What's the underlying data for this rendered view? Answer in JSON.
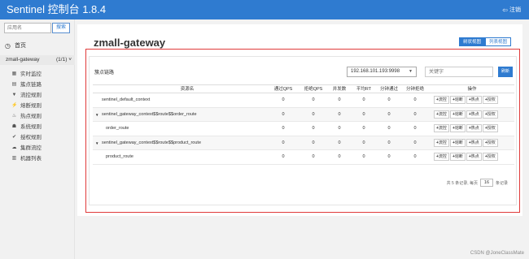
{
  "header": {
    "title": "Sentinel 控制台 1.8.4",
    "logout_label": "注销",
    "logout_icon": "logout-icon",
    "bg_color": "#2f7bd0"
  },
  "sidebar": {
    "search_placeholder": "应用名",
    "search_button": "搜索",
    "home_label": "首页",
    "app": {
      "name": "zmall-gateway",
      "count": "(1/1)"
    },
    "items": [
      {
        "icon": "chart-icon",
        "glyph": "▦",
        "label": "实时监控"
      },
      {
        "icon": "list-icon",
        "glyph": "▤",
        "label": "簇点链路"
      },
      {
        "icon": "filter-icon",
        "glyph": "▼",
        "label": "流控规则"
      },
      {
        "icon": "flash-icon",
        "glyph": "⚡",
        "label": "熔断规则"
      },
      {
        "icon": "fire-icon",
        "glyph": "♨",
        "label": "热点规则"
      },
      {
        "icon": "system-icon",
        "glyph": "☗",
        "label": "系统规则"
      },
      {
        "icon": "check-icon",
        "glyph": "✔",
        "label": "授权规则"
      },
      {
        "icon": "cloud-icon",
        "glyph": "☁",
        "label": "集群流控"
      },
      {
        "icon": "machine-icon",
        "glyph": "▥",
        "label": "机器列表"
      }
    ]
  },
  "main": {
    "page_title": "zmall-gateway",
    "view_buttons": [
      "树状视图",
      "列表视图"
    ],
    "card_title": "簇点链路",
    "machine_select": "192.168.101.193:9998",
    "keyword_placeholder": "关键字",
    "refresh_label": "刷新",
    "columns": [
      "资源名",
      "通过QPS",
      "拒绝QPS",
      "并发数",
      "平均RT",
      "分钟通过",
      "分钟拒绝",
      "操作"
    ],
    "rows": [
      {
        "name": "sentinel_default_context",
        "expand": "",
        "indent": 0,
        "values": [
          "0",
          "0",
          "0",
          "0",
          "0",
          "0"
        ]
      },
      {
        "name": "sentinel_gateway_context$$route$$order_route",
        "expand": "▼",
        "indent": 0,
        "values": [
          "0",
          "0",
          "0",
          "0",
          "0",
          "0"
        ]
      },
      {
        "name": "order_route",
        "expand": "",
        "indent": 1,
        "values": [
          "0",
          "0",
          "0",
          "0",
          "0",
          "0"
        ]
      },
      {
        "name": "sentinel_gateway_context$$route$$product_route",
        "expand": "▼",
        "indent": 0,
        "values": [
          "0",
          "0",
          "0",
          "0",
          "0",
          "0"
        ]
      },
      {
        "name": "product_route",
        "expand": "",
        "indent": 1,
        "values": [
          "0",
          "0",
          "0",
          "0",
          "0",
          "0"
        ]
      }
    ],
    "ops": [
      "流控",
      "熔断",
      "热点",
      "授权"
    ],
    "pager": {
      "prefix": "共 5 条记录, 每页",
      "page_size": "16",
      "suffix": "条记录"
    }
  },
  "watermark": "CSDN @JoneClassMate"
}
